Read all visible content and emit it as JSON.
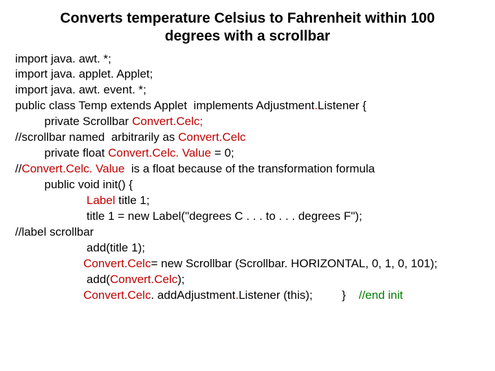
{
  "title": "Converts temperature  Celsius to Fahrenheit within 100 degrees with a scrollbar",
  "lines": {
    "l1": "import java. awt. *;",
    "l2": "import java. applet. Applet;",
    "l3": "import java. awt. event. *;",
    "l4a": "public class Temp extends Applet  implements Adjustment",
    "l4b": "Listener {",
    "l5a": "         private Scrollbar ",
    "l5b": "Convert",
    "l5c": "Celc;",
    "l6a": "//scrollbar named  arbitrarily as ",
    "l6b": "Convert",
    "l6c": "Celc",
    "l7a": "         private float ",
    "l7b": "Convert",
    "l7c": "Celc. Value ",
    "l7d": "= 0;",
    "l8a": "//",
    "l8b": "Convert",
    "l8c": "Celc. Value ",
    "l8d": " is a float because of the transformation formula",
    "l9": "         public void init() {",
    "l10a": "                      Label",
    "l10b": " title 1;",
    "l11": "                      title 1 = new Label(\"degrees C . . . to . . . degrees F\");",
    "l12": "//label scrollbar",
    "l13": "                      add(title 1);",
    "l14a": "                     ",
    "l14b": "Convert",
    "l14c": "Celc",
    "l14d": "= new Scrollbar (Scrollbar. HORIZONTAL, 0, 1, 0, 101);",
    "l15a": "                      add(",
    "l15b": "Convert",
    "l15c": "Celc",
    "l15d": ");",
    "l16a": "                     ",
    "l16b": "Convert",
    "l16c": "Celc",
    "l16d": ". add",
    "l16e": "Adjustment",
    "l16f": "Listener (this);         }   ",
    "l16g": " //end init"
  }
}
